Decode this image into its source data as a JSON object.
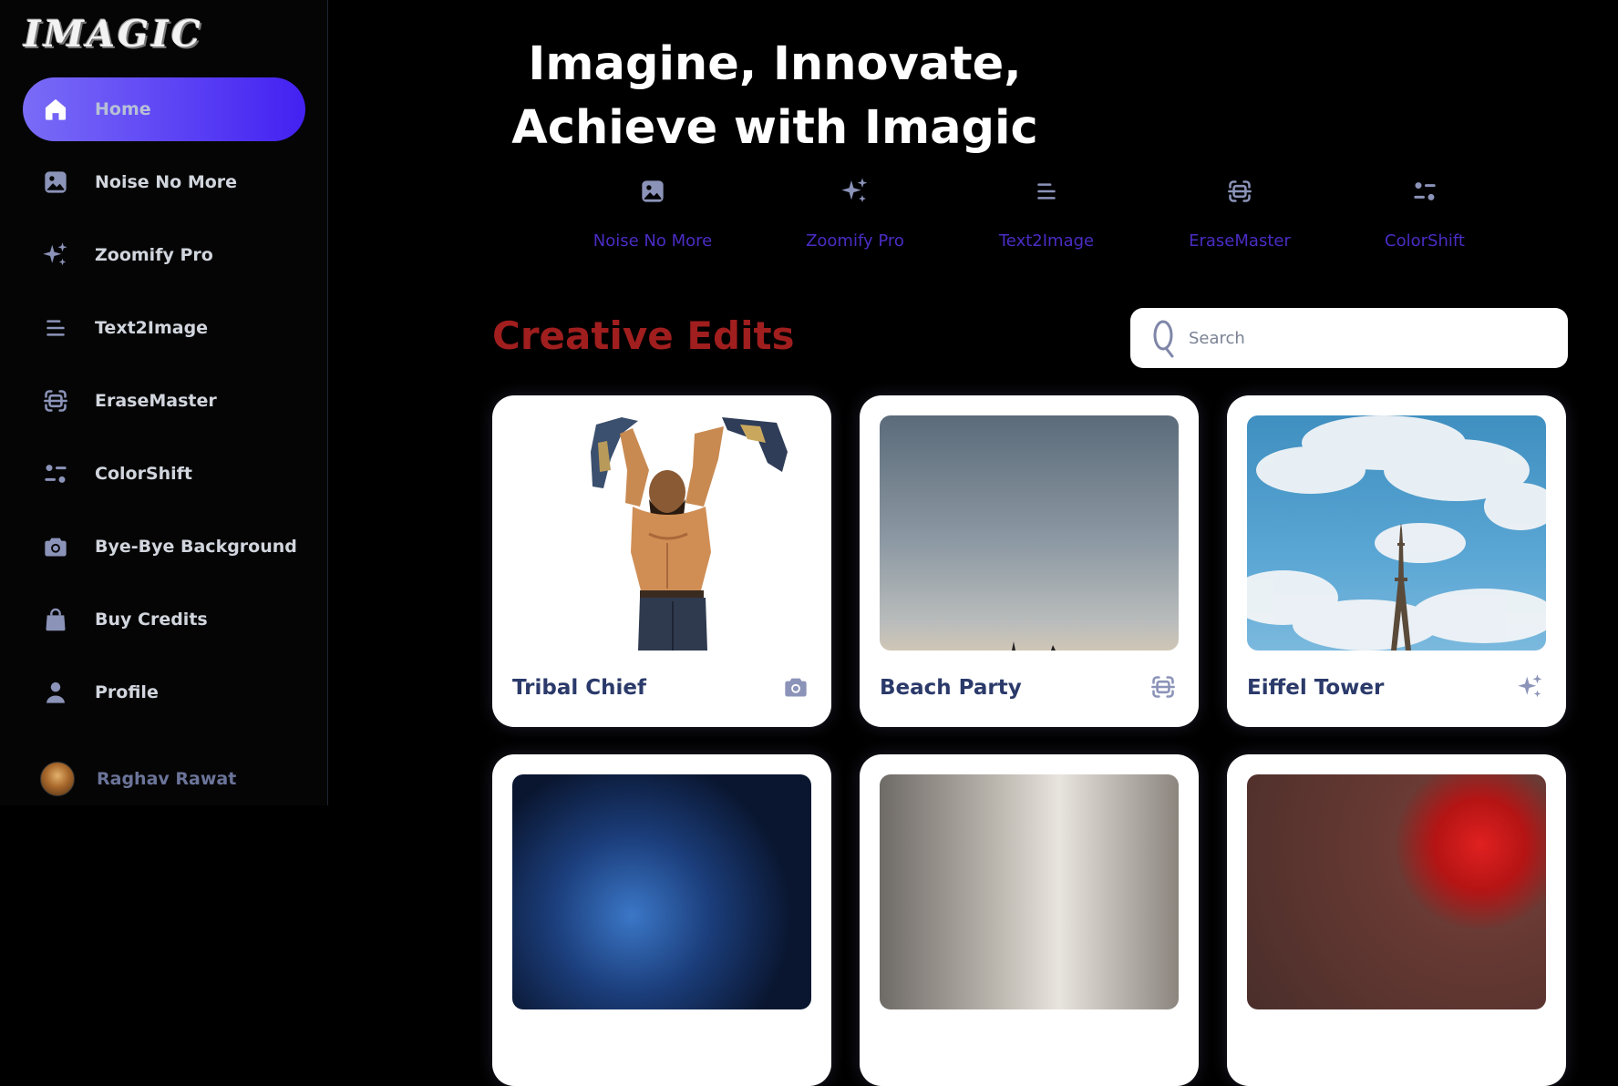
{
  "brand": {
    "logo_text": "IMAGIC"
  },
  "sidebar": {
    "items": [
      {
        "label": "Home",
        "icon": "home-icon",
        "active": true
      },
      {
        "label": "Noise No More",
        "icon": "image-icon"
      },
      {
        "label": "Zoomify Pro",
        "icon": "sparkles-icon"
      },
      {
        "label": "Text2Image",
        "icon": "text-lines-icon"
      },
      {
        "label": "EraseMaster",
        "icon": "scan-icon"
      },
      {
        "label": "ColorShift",
        "icon": "filter-icon"
      },
      {
        "label": "Bye-Bye Background",
        "icon": "camera-icon"
      },
      {
        "label": "Buy Credits",
        "icon": "bag-icon"
      },
      {
        "label": "Profile",
        "icon": "user-icon"
      }
    ],
    "user": {
      "name": "Raghav Rawat"
    }
  },
  "hero": {
    "line1": "Imagine, Innovate,",
    "line2": "Achieve with Imagic"
  },
  "quick_links": [
    {
      "label": "Noise No More",
      "icon": "image-icon"
    },
    {
      "label": "Zoomify Pro",
      "icon": "sparkles-icon"
    },
    {
      "label": "Text2Image",
      "icon": "text-lines-icon"
    },
    {
      "label": "EraseMaster",
      "icon": "scan-icon"
    },
    {
      "label": "ColorShift",
      "icon": "filter-icon"
    }
  ],
  "gallery": {
    "title": "Creative Edits",
    "search": {
      "placeholder": "Search",
      "value": ""
    },
    "cards": [
      {
        "title": "Tribal Chief",
        "icon": "camera-icon"
      },
      {
        "title": "Beach Party",
        "icon": "scan-icon"
      },
      {
        "title": "Eiffel Tower",
        "icon": "sparkles-icon"
      },
      {
        "title": "",
        "icon": ""
      },
      {
        "title": "",
        "icon": ""
      },
      {
        "title": "",
        "icon": ""
      }
    ]
  },
  "colors": {
    "accent_gradient_start": "#7a6cf7",
    "accent_gradient_end": "#4321f2",
    "icon_color": "#8b93b8",
    "quick_link_text": "#4a2cc4",
    "section_title": "#a01e1e",
    "card_title": "#2b3a6a"
  }
}
